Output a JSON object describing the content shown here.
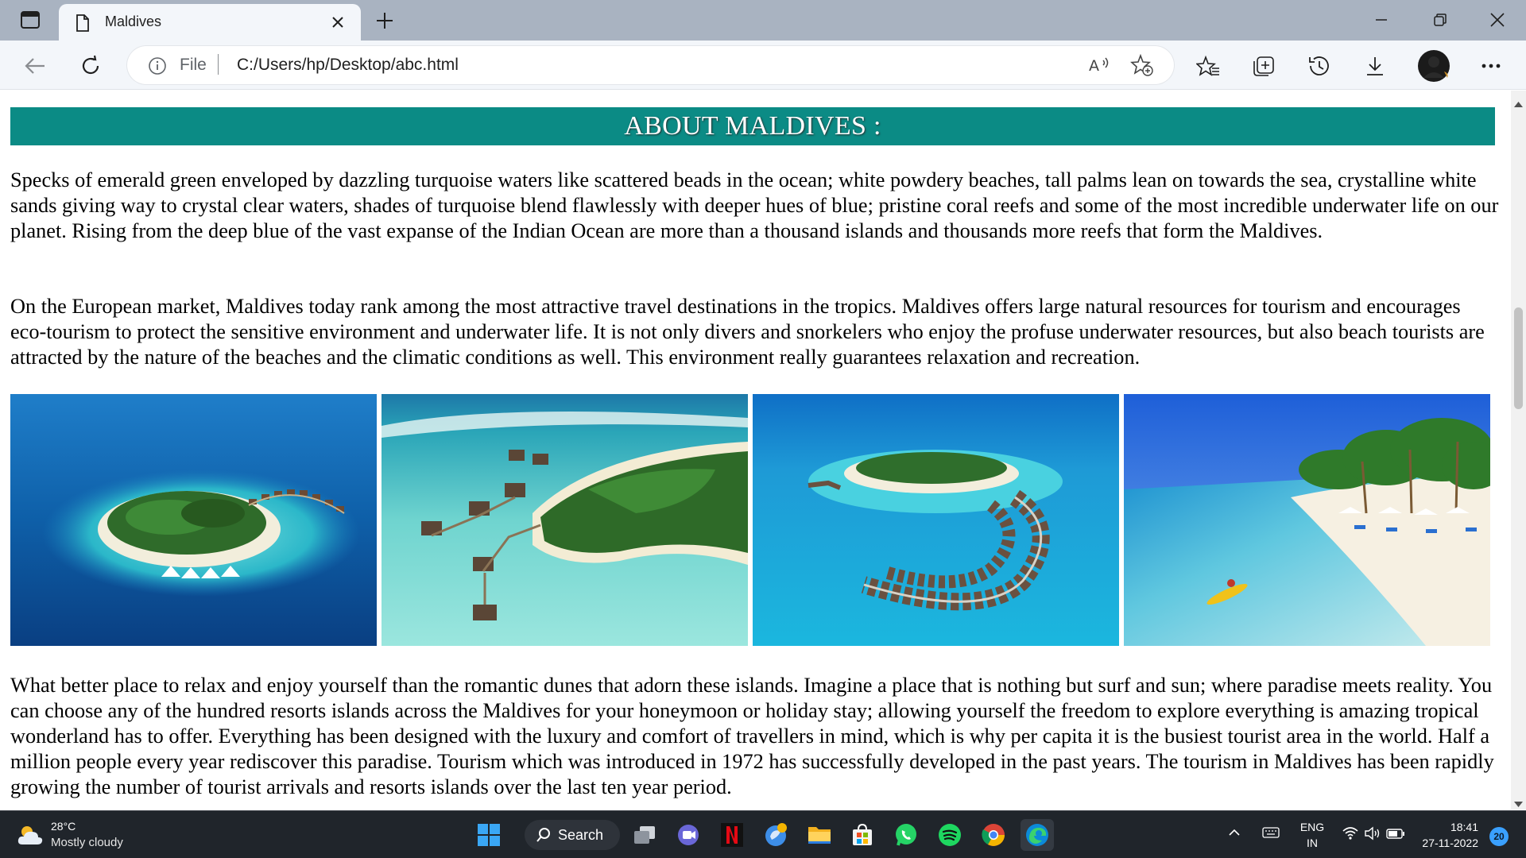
{
  "browser": {
    "tab_title": "Maldives",
    "address": {
      "scheme_label": "File",
      "url": "C:/Users/hp/Desktop/abc.html"
    }
  },
  "page": {
    "heading": "ABOUT MALDIVES :",
    "paragraphs": [
      "Specks of emerald green enveloped by dazzling turquoise waters like scattered beads in the ocean; white powdery beaches, tall palms lean on towards the sea, crystalline white sands giving way to crystal clear waters, shades of turquoise blend flawlessly with deeper hues of blue; pristine coral reefs and some of the most incredible underwater life on our planet. Rising from the deep blue of the vast expanse of the Indian Ocean are more than a thousand islands and thousands more reefs that form the Maldives.",
      "On the European market, Maldives today rank among the most attractive travel destinations in the tropics. Maldives offers large natural resources for tourism and encourages eco-tourism to protect the sensitive environment and underwater life. It is not only divers and snorkelers who enjoy the profuse underwater resources, but also beach tourists are attracted by the nature of the beaches and the climatic conditions as well. This environment really guarantees relaxation and recreation.",
      "What better place to relax and enjoy yourself than the romantic dunes that adorn these islands. Imagine a place that is nothing but surf and sun; where paradise meets reality. You can choose any of the hundred resorts islands across the Maldives for your honeymoon or holiday stay; allowing yourself the freedom to explore everything is amazing tropical wonderland has to offer. Everything has been designed with the luxury and comfort of travellers in mind, which is why per capita it is the busiest tourist area in the world. Half a million people every year rediscover this paradise. Tourism which was introduced in 1972 has successfully developed in the past years. The tourism in Maldives has been rapidly growing the number of tourist arrivals and resorts islands over the last ten year period."
    ],
    "photos": [
      {
        "subject": "round resort island with overwater villas in deep blue ocean"
      },
      {
        "subject": "aerial view of island with villas in turquoise lagoon"
      },
      {
        "subject": "curved arc of overwater bungalows around island"
      },
      {
        "subject": "white sand beach with palms, umbrellas and a yellow kayak"
      }
    ],
    "colors": {
      "heading_bg": "#0b8b85",
      "heading_text": "#ffffff"
    }
  },
  "taskbar": {
    "weather": {
      "temp": "28°C",
      "condition": "Mostly cloudy"
    },
    "search_label": "Search",
    "apps": [
      "start-icon",
      "search-icon",
      "task-view-icon",
      "teams-chat-icon",
      "netflix-icon",
      "edge-dev-icon",
      "file-explorer-icon",
      "microsoft-store-icon",
      "whatsapp-icon",
      "spotify-icon",
      "chrome-icon",
      "edge-icon"
    ],
    "language": {
      "line1": "ENG",
      "line2": "IN"
    },
    "clock": {
      "time": "18:41",
      "date": "27-11-2022"
    },
    "notifications": "20"
  }
}
